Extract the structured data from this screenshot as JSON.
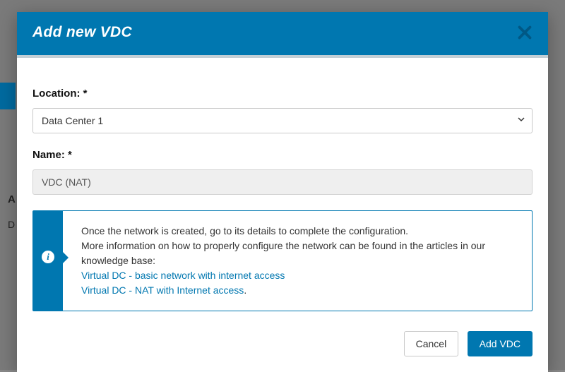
{
  "modal": {
    "title": "Add new VDC",
    "location_label": "Location: *",
    "location_value": "Data Center 1",
    "name_label": "Name: *",
    "name_value": "VDC (NAT)",
    "info_line1": "Once the network is created, go to its details to complete the configuration.",
    "info_line2": "More information on how to properly configure the network can be found in the articles in our knowledge base:",
    "kb_link1": "Virtual DC - basic network with internet access",
    "kb_link2": "Virtual DC - NAT with Internet access",
    "kb_link2_suffix": ".",
    "cancel_label": "Cancel",
    "submit_label": "Add VDC"
  },
  "background": {
    "a": "A",
    "d": "D"
  }
}
